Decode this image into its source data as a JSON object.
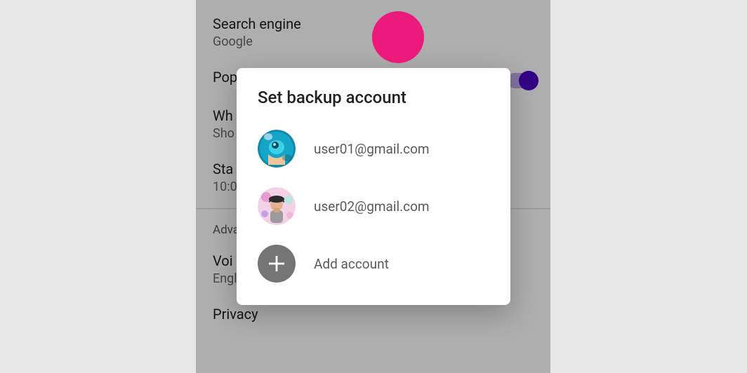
{
  "settings": {
    "items": [
      {
        "title": "Search engine",
        "sub": "Google",
        "truncTitle": "Search engine",
        "truncSub": "Google"
      },
      {
        "title": "Pop",
        "sub": "",
        "toggle": true
      },
      {
        "title": "Wh",
        "sub": "Sho"
      },
      {
        "title": "Sta",
        "sub": "10:0"
      }
    ],
    "advancedHeader": "Adva",
    "voice": {
      "title": "Voi",
      "sub": "English (US)"
    },
    "privacy": {
      "title": "Privacy"
    }
  },
  "dialog": {
    "title": "Set backup account",
    "accounts": [
      {
        "email": "user01@gmail.com"
      },
      {
        "email": "user02@gmail.com"
      }
    ],
    "addLabel": "Add account"
  }
}
